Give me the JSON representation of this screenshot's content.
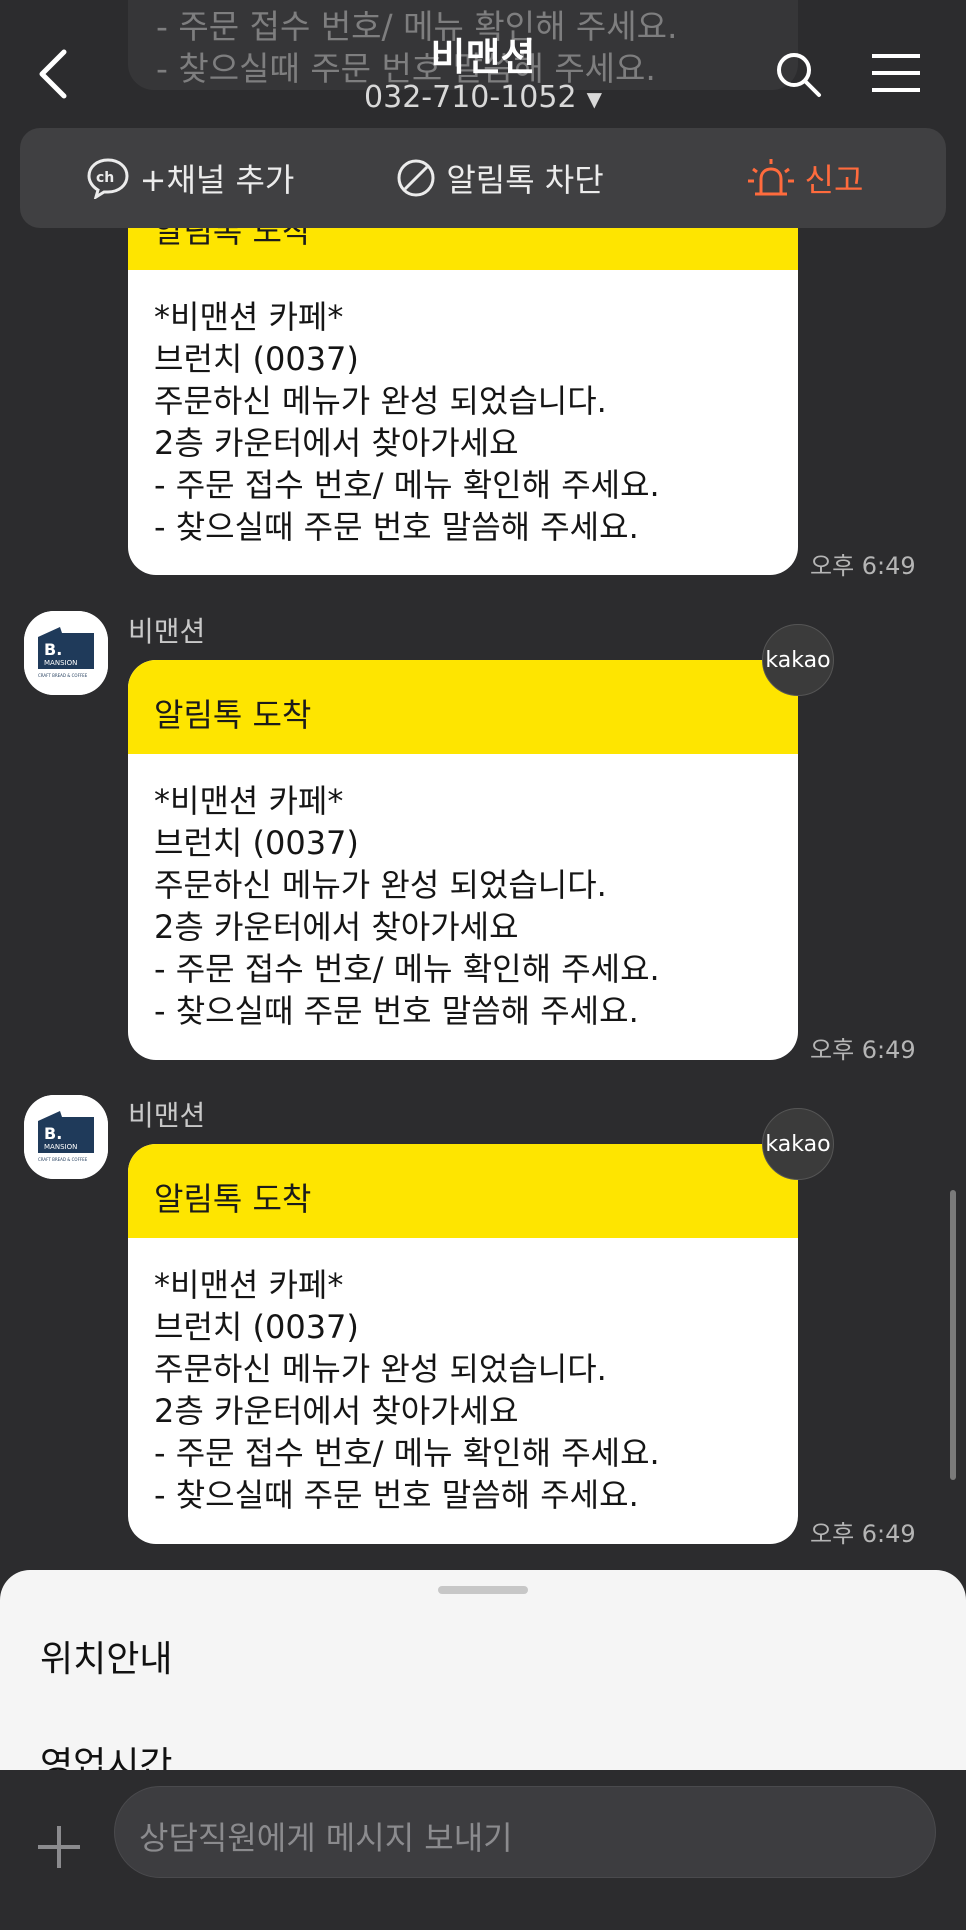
{
  "header": {
    "title": "비맨션",
    "phone": "032-710-1052",
    "actions": {
      "add_channel": "+채널 추가",
      "block": "알림톡 차단",
      "report": "신고"
    }
  },
  "top_partial": {
    "line1": "- 주문 접수 번호/ 메뉴 확인해 주세요.",
    "line2": "- 찾으실때 주문 번호 말씀해 주세요."
  },
  "messages": [
    {
      "sender": "",
      "header": "알림톡 도착",
      "body": [
        "*비맨션 카페*",
        "브런치 (0037)",
        "주문하신 메뉴가 완성 되었습니다.",
        "2층 카운터에서 찾아가세요",
        "- 주문 접수 번호/ 메뉴 확인해 주세요.",
        "- 찾으실때 주문 번호 말씀해 주세요."
      ],
      "time": "오후 6:49"
    },
    {
      "sender": "비맨션",
      "avatar_text": "B. MANSION",
      "avatar_sub": "CRAFT BREAD & COFFEE",
      "badge": "kakao",
      "header": "알림톡 도착",
      "body": [
        "*비맨션 카페*",
        "브런치 (0037)",
        "주문하신 메뉴가 완성 되었습니다.",
        "2층 카운터에서 찾아가세요",
        "- 주문 접수 번호/ 메뉴 확인해 주세요.",
        "- 찾으실때 주문 번호 말씀해 주세요."
      ],
      "time": "오후 6:49"
    },
    {
      "sender": "비맨션",
      "avatar_text": "B. MANSION",
      "avatar_sub": "CRAFT BREAD & COFFEE",
      "badge": "kakao",
      "header": "알림톡 도착",
      "body": [
        "*비맨션 카페*",
        "브런치 (0037)",
        "주문하신 메뉴가 완성 되었습니다.",
        "2층 카운터에서 찾아가세요",
        "- 주문 접수 번호/ 메뉴 확인해 주세요.",
        "- 찾으실때 주문 번호 말씀해 주세요."
      ],
      "time": "오후 6:49"
    }
  ],
  "sheet": {
    "items": [
      "위치안내",
      "영업시간"
    ]
  },
  "input": {
    "placeholder": "상담직원에게 메시지 보내기"
  },
  "colors": {
    "background": "#2c2c2e",
    "header_yellow": "#fee500",
    "report_accent": "#ff6b3d",
    "brand_navy": "#1f3a5a"
  }
}
